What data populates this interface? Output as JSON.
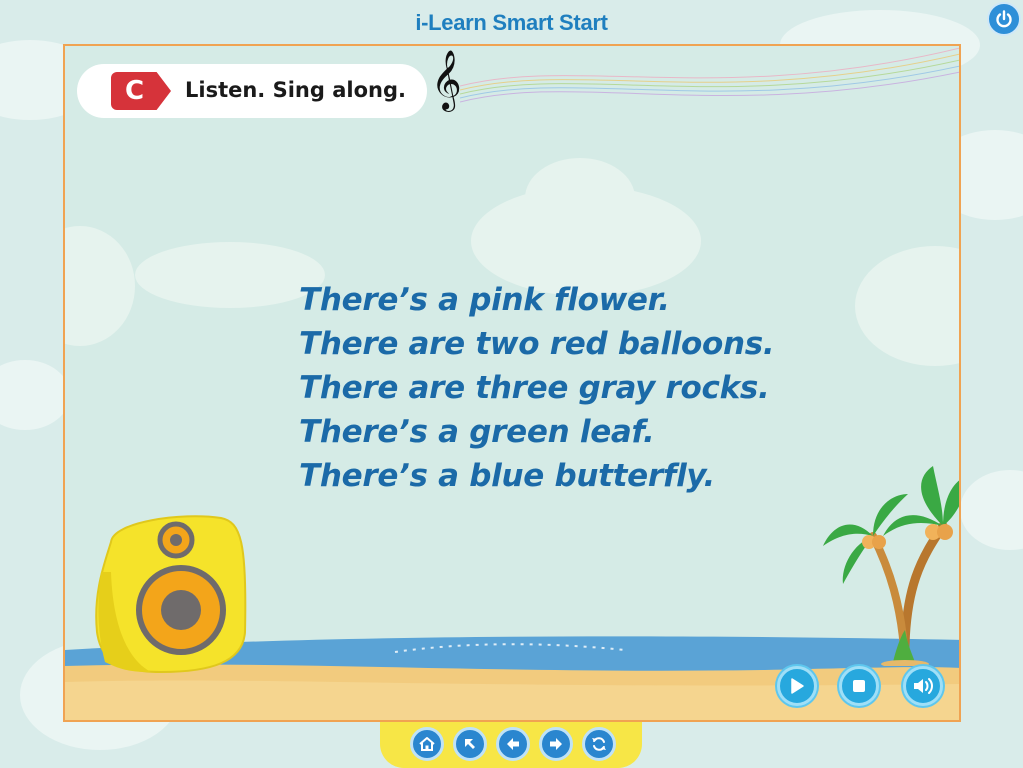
{
  "header": {
    "title": "i-Learn Smart Start"
  },
  "power": {
    "icon": "power-icon"
  },
  "activity": {
    "badge": "C",
    "instruction": "Listen. Sing along.",
    "clef_icon": "treble-clef-icon"
  },
  "lyrics": [
    "There’s a pink flower.",
    "There are two red balloons.",
    "There are three gray rocks.",
    "There’s a green leaf.",
    "There’s a blue butterfly."
  ],
  "player": {
    "buttons": [
      {
        "name": "play-button",
        "icon": "play-icon"
      },
      {
        "name": "stop-button",
        "icon": "stop-icon"
      },
      {
        "name": "volume-button",
        "icon": "volume-icon"
      }
    ]
  },
  "nav": {
    "buttons": [
      {
        "name": "home-button",
        "icon": "home-icon"
      },
      {
        "name": "menu-button",
        "icon": "arrow-up-left-icon"
      },
      {
        "name": "back-button",
        "icon": "arrow-left-icon"
      },
      {
        "name": "next-button",
        "icon": "arrow-right-icon"
      },
      {
        "name": "replay-button",
        "icon": "refresh-icon"
      }
    ]
  },
  "colors": {
    "accent": "#1b6aa8",
    "border": "#f0a352",
    "badge": "#d6333a",
    "button": "#27a8de",
    "nav_bar": "#f7e646"
  }
}
